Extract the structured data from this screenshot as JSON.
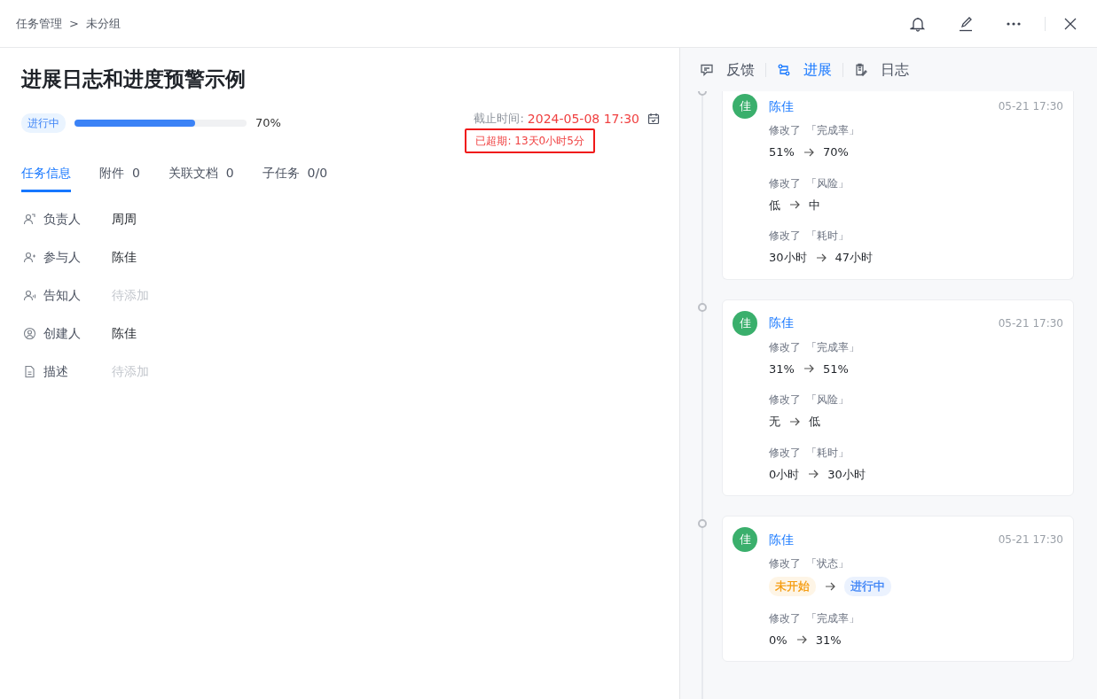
{
  "breadcrumb": [
    "任务管理",
    "未分组"
  ],
  "breadcrumb_separator": ">",
  "title": "进展日志和进度预警示例",
  "status_tag": "进行中",
  "progress": {
    "level": 0.7,
    "reading": "70%"
  },
  "deadline": {
    "label": "截止时间:",
    "value": "2024-05-08 17:30"
  },
  "overdue": {
    "text": "已超期: 13天0小时5分",
    "highlighted": true
  },
  "tabs": [
    {
      "label": "任务信息",
      "selected": true
    },
    {
      "label": "附件",
      "count": "0",
      "selected": false
    },
    {
      "label": "关联文档",
      "count": "0",
      "selected": false
    },
    {
      "label": "子任务",
      "count": "0/0",
      "selected": false
    }
  ],
  "fields": [
    {
      "label": "负责人",
      "value": "周周"
    },
    {
      "label": "参与人",
      "value": "陈佳"
    },
    {
      "label": "告知人",
      "placeholder": "待添加"
    },
    {
      "label": "创建人",
      "value": "陈佳"
    },
    {
      "label": "描述",
      "placeholder": "待添加"
    }
  ],
  "side_tabs": [
    {
      "label": "反馈",
      "selected": false
    },
    {
      "label": "进展",
      "selected": true
    },
    {
      "label": "日志",
      "selected": false
    }
  ],
  "entries": [
    {
      "avatar": "佳",
      "user": "陈佳",
      "time": "05-21 17:30",
      "changes": [
        {
          "action": "修改了",
          "field": "「完成率」",
          "kind": "text",
          "from": "51%",
          "to": "70%"
        },
        {
          "action": "修改了",
          "field": "「风险」",
          "kind": "text",
          "from": "低",
          "to": "中"
        },
        {
          "action": "修改了",
          "field": "「耗时」",
          "kind": "text",
          "from": "30小时",
          "to": "47小时"
        }
      ]
    },
    {
      "avatar": "佳",
      "user": "陈佳",
      "time": "05-21 17:30",
      "changes": [
        {
          "action": "修改了",
          "field": "「完成率」",
          "kind": "text",
          "from": "31%",
          "to": "51%"
        },
        {
          "action": "修改了",
          "field": "「风险」",
          "kind": "text",
          "from": "无",
          "to": "低"
        },
        {
          "action": "修改了",
          "field": "「耗时」",
          "kind": "text",
          "from": "0小时",
          "to": "30小时"
        }
      ]
    },
    {
      "avatar": "佳",
      "user": "陈佳",
      "time": "05-21 17:30",
      "changes": [
        {
          "action": "修改了",
          "field": "「状态」",
          "kind": "tag",
          "from": {
            "text": "未开始",
            "color": "#f59a0b"
          },
          "to": {
            "text": "进行中",
            "color": "#3b82f6"
          }
        },
        {
          "action": "修改了",
          "field": "「完成率」",
          "kind": "text",
          "from": "0%",
          "to": "31%"
        }
      ]
    }
  ]
}
